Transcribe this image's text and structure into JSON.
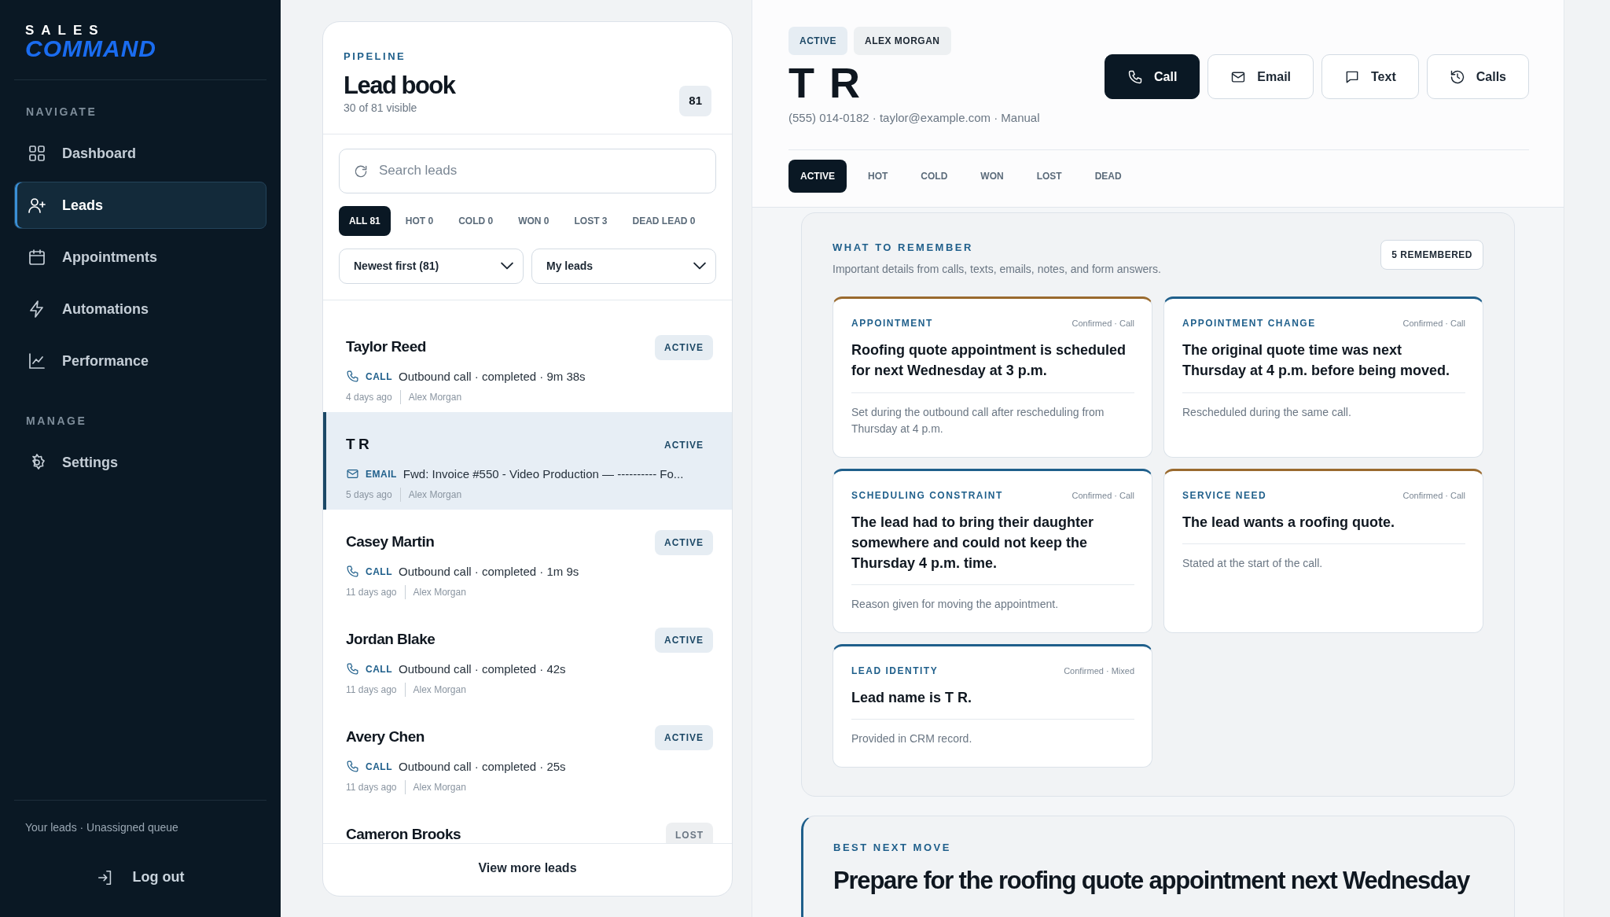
{
  "sidebar": {
    "logo_top": "SALES",
    "logo_bottom": "COMMAND",
    "sections": [
      {
        "title": "NAVIGATE",
        "items": [
          {
            "label": "Dashboard",
            "selected": false
          },
          {
            "label": "Leads",
            "selected": true
          },
          {
            "label": "Appointments",
            "selected": false
          },
          {
            "label": "Automations",
            "selected": false
          },
          {
            "label": "Performance",
            "selected": false
          }
        ]
      },
      {
        "title": "MANAGE",
        "items": [
          {
            "label": "Settings",
            "selected": false
          }
        ]
      }
    ],
    "footer": "Your leads · Unassigned queue",
    "logout": "Log out"
  },
  "lead_panel": {
    "eyebrow": "PIPELINE",
    "title": "Lead book",
    "subtitle": "30 of 81 visible",
    "count": "81",
    "search": {
      "placeholder": "Search leads"
    },
    "filters": [
      {
        "label": "ALL 81",
        "selected": true
      },
      {
        "label": "HOT 0",
        "selected": false
      },
      {
        "label": "COLD 0",
        "selected": false
      },
      {
        "label": "WON 0",
        "selected": false
      },
      {
        "label": "LOST 3",
        "selected": false
      },
      {
        "label": "DEAD LEAD 0",
        "selected": false
      }
    ],
    "selects": [
      {
        "value": "Newest first (81)"
      },
      {
        "value": "My leads"
      }
    ],
    "leads": [
      {
        "name": "Taylor Reed",
        "status": {
          "label": "ACTIVE",
          "kind": "active"
        },
        "channel": {
          "label": "CALL",
          "kind": "call"
        },
        "summary": "Outbound call · completed · 9m 38s",
        "age": "4 days ago",
        "owner": "Alex Morgan",
        "selected": false
      },
      {
        "name": "T R",
        "status": {
          "label": "ACTIVE",
          "kind": "active"
        },
        "channel": {
          "label": "EMAIL",
          "kind": "email"
        },
        "summary": "Fwd: Invoice #550 - Video Production — ---------- Fo...",
        "age": "5 days ago",
        "owner": "Alex Morgan",
        "selected": true
      },
      {
        "name": "Casey Martin",
        "status": {
          "label": "ACTIVE",
          "kind": "active"
        },
        "channel": {
          "label": "CALL",
          "kind": "call"
        },
        "summary": "Outbound call · completed · 1m 9s",
        "age": "11 days ago",
        "owner": "Alex Morgan",
        "selected": false
      },
      {
        "name": "Jordan Blake",
        "status": {
          "label": "ACTIVE",
          "kind": "active"
        },
        "channel": {
          "label": "CALL",
          "kind": "call"
        },
        "summary": "Outbound call · completed · 42s",
        "age": "11 days ago",
        "owner": "Alex Morgan",
        "selected": false
      },
      {
        "name": "Avery Chen",
        "status": {
          "label": "ACTIVE",
          "kind": "active"
        },
        "channel": {
          "label": "CALL",
          "kind": "call"
        },
        "summary": "Outbound call · completed · 25s",
        "age": "11 days ago",
        "owner": "Alex Morgan",
        "selected": false
      },
      {
        "name": "Cameron Brooks",
        "status": {
          "label": "LOST",
          "kind": "lost"
        },
        "selected": false
      }
    ],
    "view_more": "View more leads"
  },
  "detail": {
    "tags": [
      {
        "label": "ACTIVE",
        "kind": "status"
      },
      {
        "label": "ALEX MORGAN",
        "kind": "owner"
      }
    ],
    "name": "T R",
    "contact": "(555) 014-0182 · taylor@example.com · Manual",
    "actions": [
      {
        "label": "Call",
        "kind": "primary"
      },
      {
        "label": "Email",
        "kind": "outline"
      },
      {
        "label": "Text",
        "kind": "outline"
      },
      {
        "label": "Calls",
        "kind": "outline"
      }
    ],
    "stage_tabs": [
      {
        "label": "ACTIVE",
        "selected": true
      },
      {
        "label": "HOT",
        "selected": false
      },
      {
        "label": "COLD",
        "selected": false
      },
      {
        "label": "WON",
        "selected": false
      },
      {
        "label": "LOST",
        "selected": false
      },
      {
        "label": "DEAD",
        "selected": false
      }
    ],
    "memory": {
      "title": "WHAT TO REMEMBER",
      "subtitle": "Important details from calls, texts, emails, notes, and form answers.",
      "count": "5 REMEMBERED",
      "items": [
        {
          "category": "APPOINTMENT",
          "source": "Confirmed · Call",
          "fact": "Roofing quote appointment is scheduled for next Wednesday at 3 p.m.",
          "note": "Set during the outbound call after rescheduling from Thursday at 4 p.m.",
          "color": "#9a6a2e"
        },
        {
          "category": "APPOINTMENT CHANGE",
          "source": "Confirmed · Call",
          "fact": "The original quote time was next Thursday at 4 p.m. before being moved.",
          "note": "Rescheduled during the same call.",
          "color": "#1f5f8b"
        },
        {
          "category": "SCHEDULING CONSTRAINT",
          "source": "Confirmed · Call",
          "fact": "The lead had to bring their daughter somewhere and could not keep the Thursday 4 p.m. time.",
          "note": "Reason given for moving the appointment.",
          "color": "#1f5f8b"
        },
        {
          "category": "SERVICE NEED",
          "source": "Confirmed · Call",
          "fact": "The lead wants a roofing quote.",
          "note": "Stated at the start of the call.",
          "color": "#9a6a2e"
        },
        {
          "category": "LEAD IDENTITY",
          "source": "Confirmed · Mixed",
          "fact": "Lead name is T R.",
          "note": "Provided in CRM record.",
          "color": "#1f5f8b"
        }
      ]
    },
    "best_move": {
      "eyebrow": "BEST NEXT MOVE",
      "headline": "Prepare for the roofing quote appointment next Wednesday"
    }
  }
}
